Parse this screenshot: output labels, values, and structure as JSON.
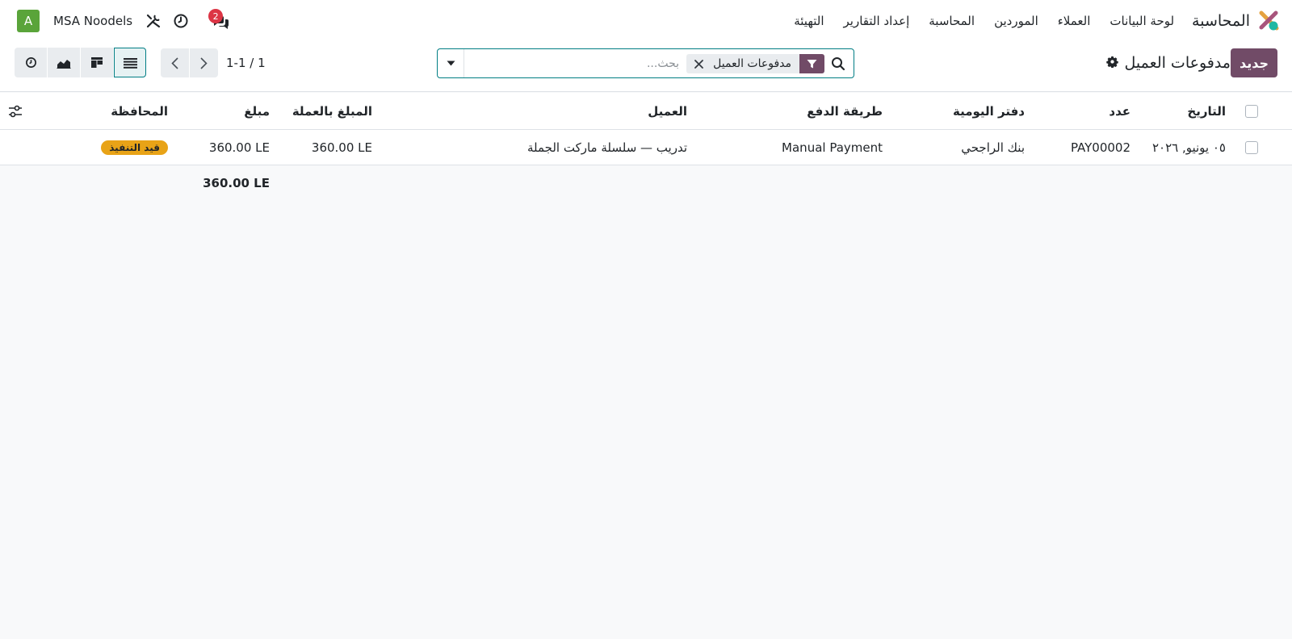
{
  "navbar": {
    "app_name": "المحاسبة",
    "menu": [
      "لوحة البيانات",
      "العملاء",
      "الموردين",
      "المحاسبة",
      "إعداد التقارير",
      "التهيئة"
    ],
    "company": "MSA Noodels",
    "avatar_letter": "A",
    "chat_badge": "2",
    "icons": {
      "tools": "tools-icon",
      "activity": "clock-icon",
      "chat": "chat-icon"
    }
  },
  "control": {
    "new_button": "جديد",
    "title": "مدفوعات العميل",
    "search": {
      "facet_label": "مدفوعات العميل",
      "placeholder": "بحث...",
      "value": ""
    },
    "pager": "1-1 / 1",
    "views": [
      "activity-view-icon",
      "graph-view-icon",
      "kanban-view-icon",
      "list-view-icon"
    ],
    "active_view": "list"
  },
  "table": {
    "headers": {
      "date": "التاريخ",
      "number": "عدد",
      "journal": "دفتر اليومية",
      "payment_method": "طريقة الدفع",
      "customer": "العميل",
      "amount_currency": "المبلغ بالعملة",
      "amount": "مبلغ",
      "status": "المحافظة"
    },
    "rows": [
      {
        "date": "٠٥ يونيو, ٢٠٢٦",
        "number": "PAY00002",
        "journal": "بنك الراجحي",
        "payment_method": "Manual Payment",
        "customer": "تدريب — سلسلة ماركت الجملة",
        "amount_currency": "360.00 LE",
        "amount": "360.00 LE",
        "status": "قيد التنفيذ"
      }
    ],
    "total_amount": "360.00 LE"
  },
  "colors": {
    "brand": "#714b67",
    "accent": "#017e84",
    "status_pill": "#e8a317",
    "badge": "#dc3545",
    "avatar": "#5aa43a"
  }
}
